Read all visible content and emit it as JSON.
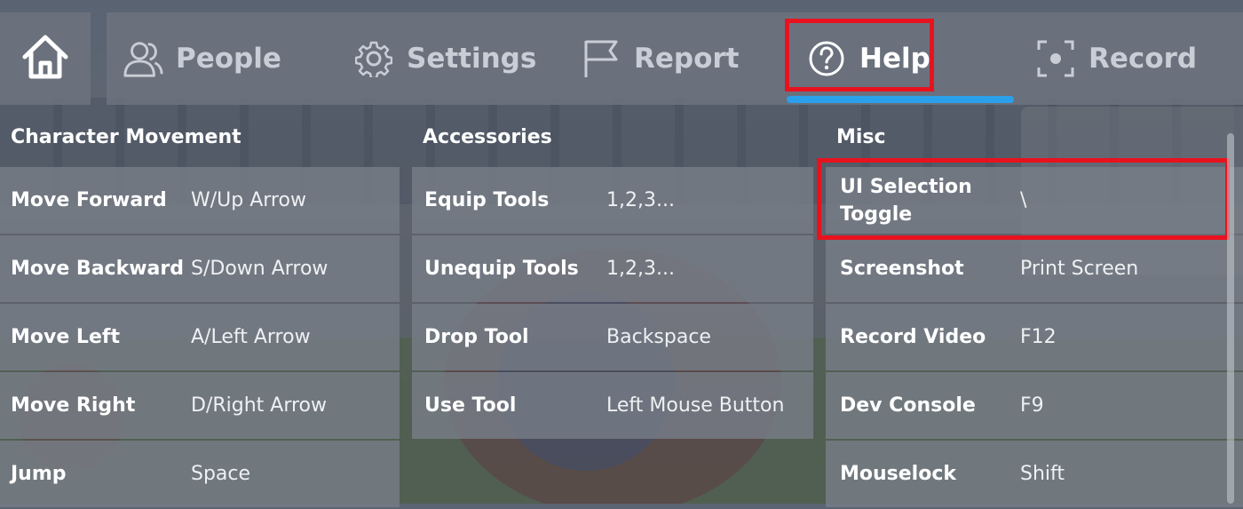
{
  "nav": {
    "home_icon": "home-icon",
    "tabs": [
      {
        "label": "People",
        "icon": "people-icon"
      },
      {
        "label": "Settings",
        "icon": "gear-icon"
      },
      {
        "label": "Report",
        "icon": "flag-icon"
      },
      {
        "label": "Help",
        "icon": "help-circle-icon",
        "active": true
      },
      {
        "label": "Record",
        "icon": "record-icon"
      }
    ],
    "active_tab_color": "#2aa0ea",
    "highlight_color": "#e8121e"
  },
  "columns": [
    {
      "title": "Character Movement",
      "rows": [
        {
          "action": "Move Forward",
          "key": "W/Up Arrow"
        },
        {
          "action": "Move Backward",
          "key": "S/Down Arrow"
        },
        {
          "action": "Move Left",
          "key": "A/Left Arrow"
        },
        {
          "action": "Move Right",
          "key": "D/Right Arrow"
        },
        {
          "action": "Jump",
          "key": "Space"
        }
      ]
    },
    {
      "title": "Accessories",
      "rows": [
        {
          "action": "Equip Tools",
          "key": "1,2,3..."
        },
        {
          "action": "Unequip Tools",
          "key": "1,2,3..."
        },
        {
          "action": "Drop Tool",
          "key": "Backspace"
        },
        {
          "action": "Use Tool",
          "key": "Left Mouse Button"
        }
      ]
    },
    {
      "title": "Misc",
      "rows": [
        {
          "action": "UI Selection Toggle",
          "key": "\\"
        },
        {
          "action": "Screenshot",
          "key": "Print Screen"
        },
        {
          "action": "Record Video",
          "key": "F12"
        },
        {
          "action": "Dev Console",
          "key": "F9"
        },
        {
          "action": "Mouselock",
          "key": "Shift"
        }
      ]
    }
  ]
}
